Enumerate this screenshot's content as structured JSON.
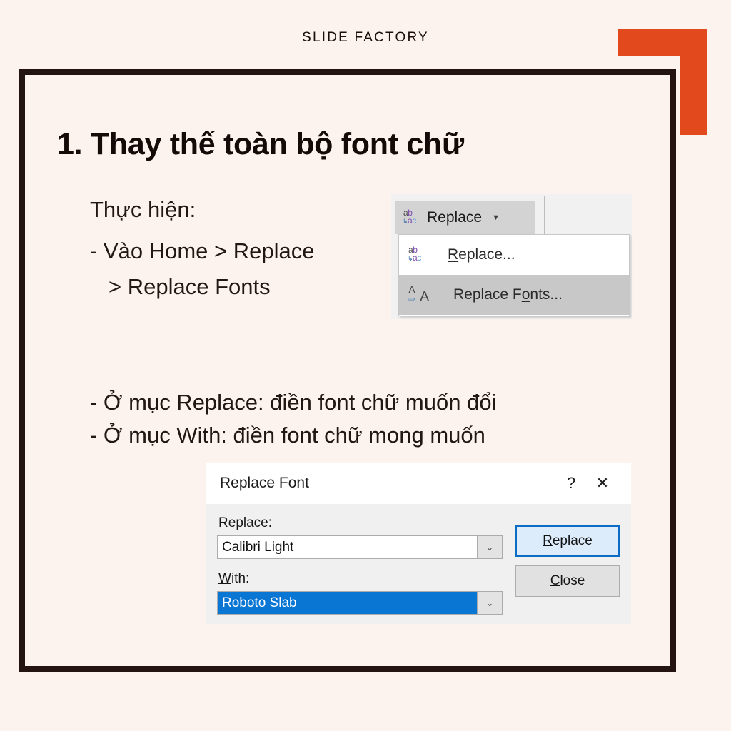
{
  "slide": {
    "brand": "SLIDE FACTORY",
    "heading": "1. Thay thế toàn bộ font chữ",
    "lead": "Thực hiện:",
    "step_line_1": "- Vào Home > Replace",
    "step_line_2": "> Replace Fonts",
    "note_line_1": "- Ở mục Replace: điền font chữ muốn đổi",
    "note_line_2": "- Ở mục With: điền font chữ mong muốn",
    "accent_color": "#E2491D",
    "frame_color": "#241411",
    "background_color": "#FCF2EE"
  },
  "ribbon": {
    "button_label": "Replace",
    "button_icon": "abac-replace-icon",
    "caret_icon": "chevron-down-icon",
    "menu": {
      "items": [
        {
          "label_before": "",
          "label_underlined": "R",
          "label_after": "eplace...",
          "icon": "abac-replace-icon",
          "selected": false
        },
        {
          "label_before": "Replace F",
          "label_underlined": "o",
          "label_after": "nts...",
          "icon": "replace-fonts-icon",
          "selected": true
        }
      ]
    }
  },
  "dialog": {
    "title": "Replace Font",
    "help_glyph": "?",
    "close_glyph": "✕",
    "replace_label_before": "R",
    "replace_label_underlined": "e",
    "replace_label_after": "place:",
    "replace_value": "Calibri Light",
    "with_label_underlined": "W",
    "with_label_after": "ith:",
    "with_value": "Roboto Slab",
    "with_value_selected": true,
    "selection_color": "#0A76D4",
    "combo_arrow_icon": "chevron-down-icon",
    "buttons": [
      {
        "before": "",
        "underlined": "R",
        "after": "eplace",
        "default": true
      },
      {
        "before": "",
        "underlined": "C",
        "after": "lose",
        "default": false
      }
    ]
  }
}
